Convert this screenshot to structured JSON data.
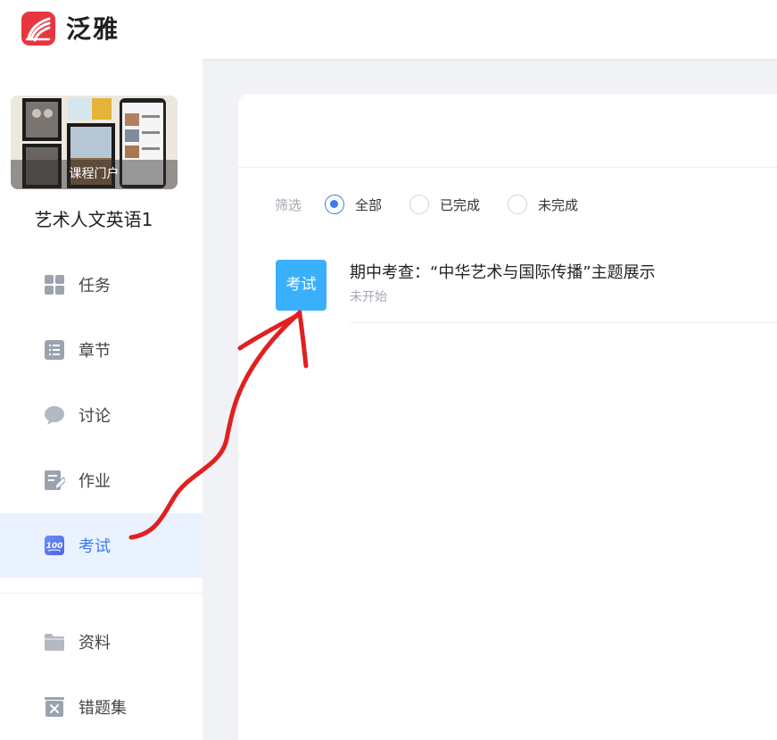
{
  "header": {
    "app_name": "泛雅",
    "logo_icon": "chaoxing-logo-icon",
    "brand_color": "#e8353f"
  },
  "sidebar": {
    "cover_label": "课程门户",
    "course_name": "艺术人文英语1",
    "items": [
      {
        "label": "任务",
        "icon": "grid-icon"
      },
      {
        "label": "章节",
        "icon": "list-icon"
      },
      {
        "label": "讨论",
        "icon": "chat-bubble-icon"
      },
      {
        "label": "作业",
        "icon": "edit-document-icon"
      },
      {
        "label": "考试",
        "icon": "exam-100-icon",
        "active": true
      },
      {
        "label": "资料",
        "icon": "folder-icon"
      },
      {
        "label": "错题集",
        "icon": "wrong-answers-icon"
      }
    ],
    "active_color": "#3a7bf0",
    "active_bg": "#eaf2ff"
  },
  "main": {
    "filter": {
      "label": "筛选",
      "options": [
        "全部",
        "已完成",
        "未完成"
      ],
      "selected": "全部"
    },
    "tasks": [
      {
        "badge": "考试",
        "title": "期中考查：“中华艺术与国际传播”主题展示",
        "status": "未开始",
        "badge_color": "#3ab0fb"
      }
    ]
  },
  "annotation": {
    "color": "#e02020"
  }
}
